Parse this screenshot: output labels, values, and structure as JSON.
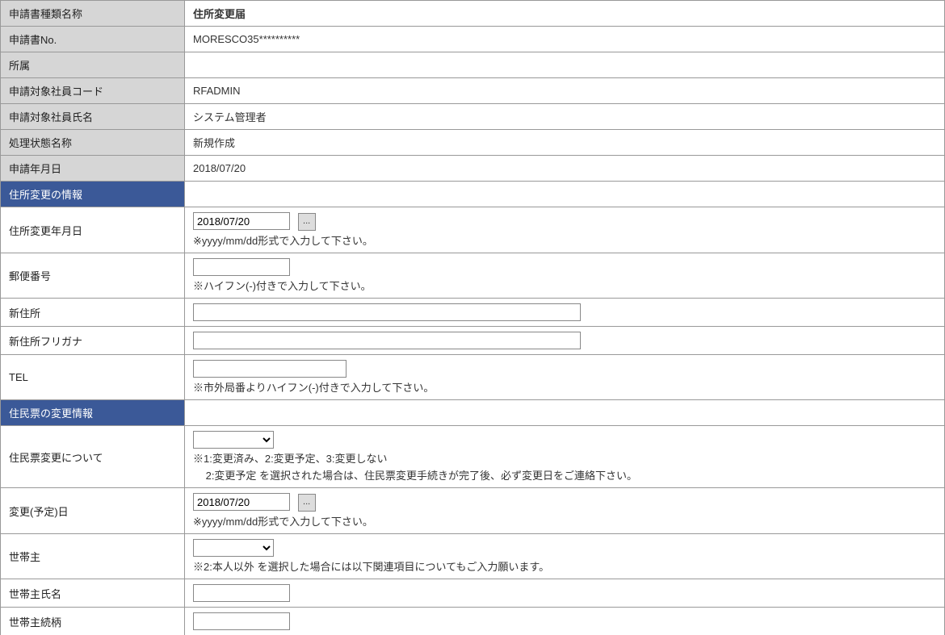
{
  "header": {
    "labels": {
      "docType": "申請書種類名称",
      "docNo": "申請書No.",
      "affiliation": "所属",
      "empCode": "申請対象社員コード",
      "empName": "申請対象社員氏名",
      "status": "処理状態名称",
      "applyDate": "申請年月日"
    },
    "values": {
      "docType": "住所変更届",
      "docNo": "MORESCO35**********",
      "affiliation": "",
      "empCode": "RFADMIN",
      "empName": "システム管理者",
      "status": "新規作成",
      "applyDate": "2018/07/20"
    }
  },
  "section1": {
    "title": "住所変更の情報",
    "labels": {
      "changeDate": "住所変更年月日",
      "postal": "郵便番号",
      "newAddress": "新住所",
      "newAddressKana": "新住所フリガナ",
      "tel": "TEL"
    },
    "notes": {
      "dateFormat": "※yyyy/mm/dd形式で入力して下さい。",
      "hyphen": "※ハイフン(-)付きで入力して下さい。",
      "telHyphen": "※市外局番よりハイフン(-)付きで入力して下さい。"
    },
    "values": {
      "changeDate": "2018/07/20"
    }
  },
  "section2": {
    "title": "住民票の変更情報",
    "labels": {
      "residentChange": "住民票変更について",
      "planDate": "変更(予定)日",
      "householder": "世帯主",
      "householderName": "世帯主氏名",
      "householderRelation": "世帯主続柄"
    },
    "notes": {
      "residentChange1": "※1:変更済み、2:変更予定、3:変更しない",
      "residentChange2": "2:変更予定 を選択された場合は、住民票変更手続きが完了後、必ず変更日をご連絡下さい。",
      "dateFormat": "※yyyy/mm/dd形式で入力して下さい。",
      "householder": "※2:本人以外 を選択した場合には以下関連項目についてもご入力願います。"
    },
    "values": {
      "planDate": "2018/07/20"
    }
  },
  "icons": {
    "picker": "..."
  }
}
